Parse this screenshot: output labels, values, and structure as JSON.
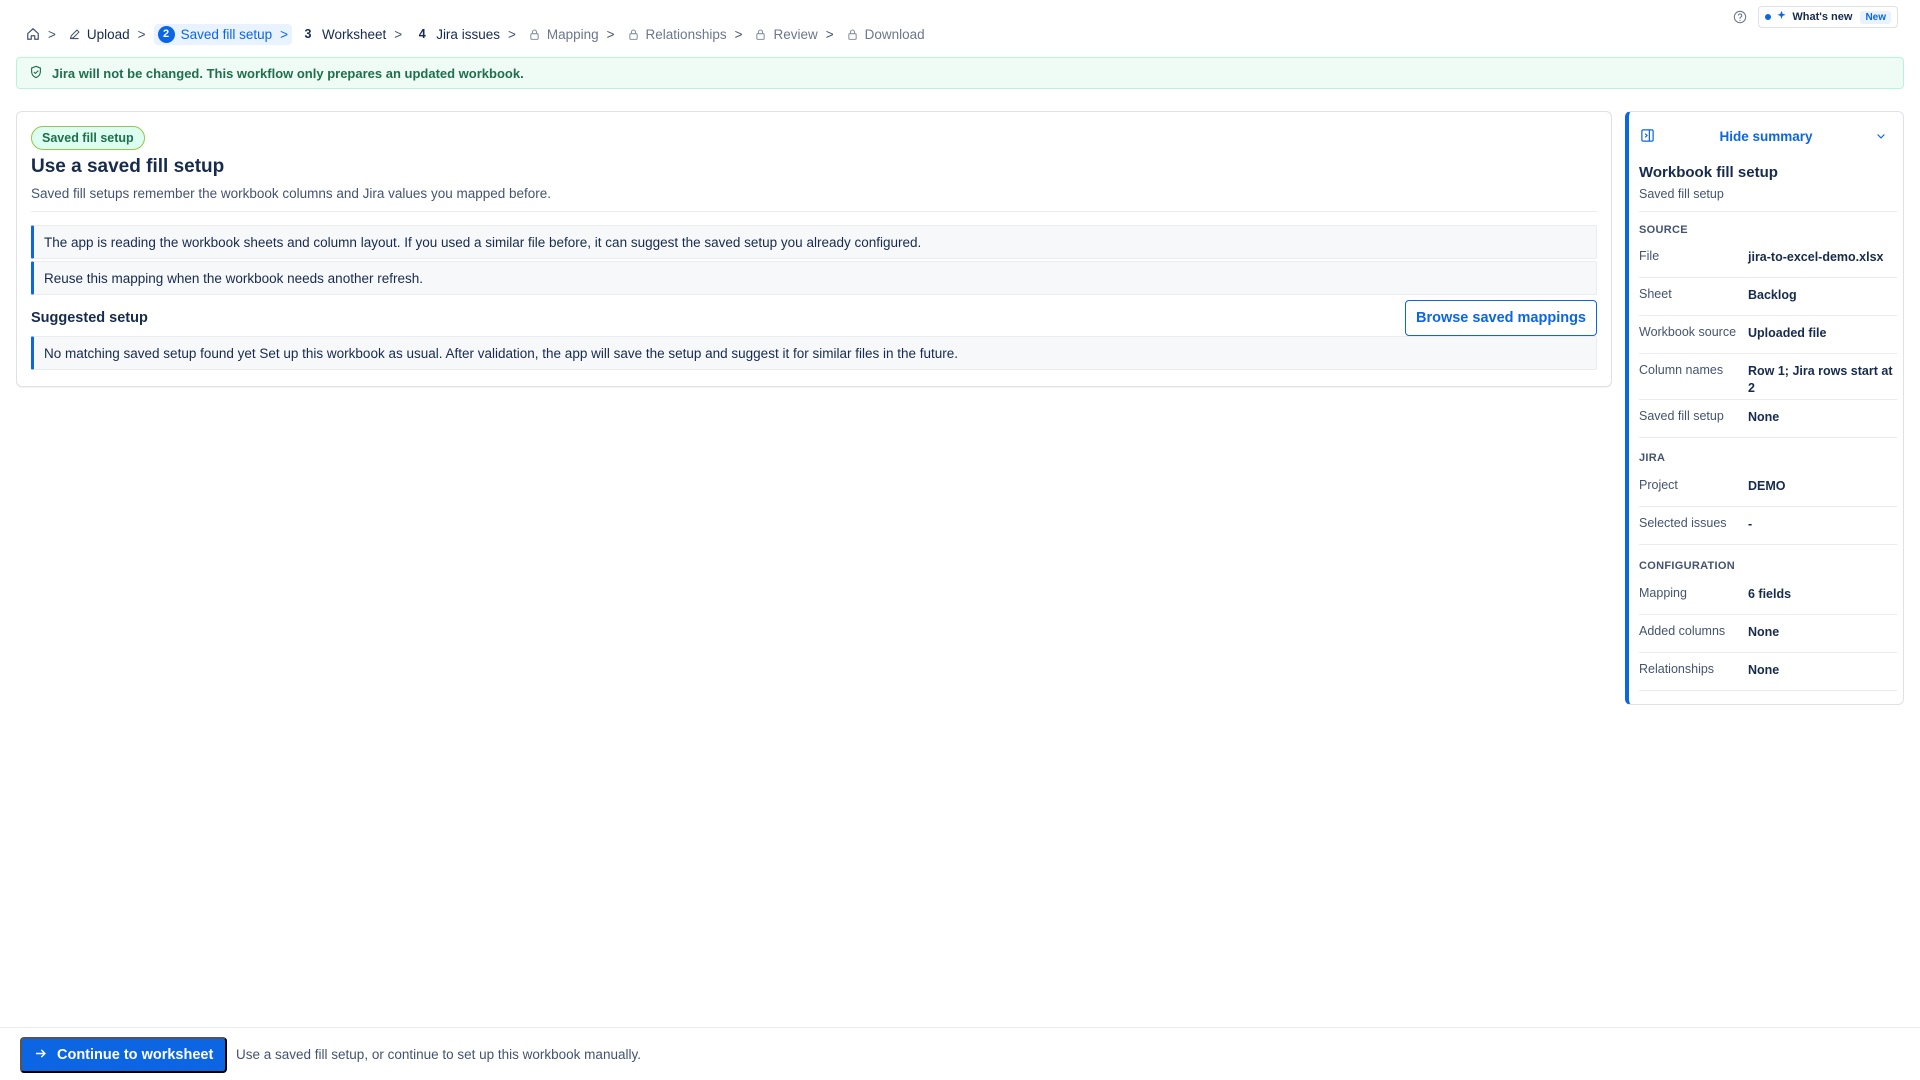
{
  "breadcrumb": {
    "separator": ">",
    "steps": [
      {
        "label": "Upload",
        "state": "done"
      },
      {
        "label": "Saved fill setup",
        "number": "2",
        "state": "active"
      },
      {
        "label": "Worksheet",
        "number": "3",
        "state": "open"
      },
      {
        "label": "Jira issues",
        "number": "4",
        "state": "open"
      },
      {
        "label": "Mapping",
        "state": "locked"
      },
      {
        "label": "Relationships",
        "state": "locked"
      },
      {
        "label": "Review",
        "state": "locked"
      },
      {
        "label": "Download",
        "state": "locked"
      }
    ]
  },
  "header": {
    "whats_new_label": "What's new",
    "whats_new_badge": "New"
  },
  "banner": {
    "text": "Jira will not be changed. This workflow only prepares an updated workbook."
  },
  "main": {
    "pill": "Saved fill setup",
    "title": "Use a saved fill setup",
    "description": "Saved fill setups remember the workbook columns and Jira values you mapped before.",
    "info_1": "The app is reading the workbook sheets and column layout. If you used a similar file before, it can suggest the saved setup you already configured.",
    "info_2": "Reuse this mapping when the workbook needs another refresh.",
    "suggested_heading": "Suggested setup",
    "browse_button": "Browse saved mappings",
    "no_match": "No matching saved setup found yet Set up this workbook as usual. After validation, the app will save the setup and suggest it for similar files in the future."
  },
  "summary": {
    "hide_label": "Hide summary",
    "title": "Workbook fill setup",
    "subtitle": "Saved fill setup",
    "source_heading": "SOURCE",
    "source": [
      {
        "k": "File",
        "v": "jira-to-excel-demo.xlsx"
      },
      {
        "k": "Sheet",
        "v": "Backlog"
      },
      {
        "k": "Workbook source",
        "v": "Uploaded file"
      },
      {
        "k": "Column names",
        "v": "Row 1; Jira rows start at 2"
      },
      {
        "k": "Saved fill setup",
        "v": "None"
      }
    ],
    "jira_heading": "JIRA",
    "jira": [
      {
        "k": "Project",
        "v": "DEMO"
      },
      {
        "k": "Selected issues",
        "v": "-"
      }
    ],
    "config_heading": "CONFIGURATION",
    "config": [
      {
        "k": "Mapping",
        "v": "6 fields"
      },
      {
        "k": "Added columns",
        "v": "None"
      },
      {
        "k": "Relationships",
        "v": "None"
      }
    ]
  },
  "footer": {
    "continue_button": "Continue to worksheet",
    "hint": "Use a saved fill setup, or continue to set up this workbook manually."
  },
  "colors": {
    "brand": "#0c66e4",
    "success_bg": "#effcf6",
    "success_text": "#216e4e"
  },
  "icons": [
    "home-icon",
    "pencil-icon",
    "lock-icon",
    "help-icon",
    "sparkle-icon",
    "shield-check-icon",
    "panel-icon",
    "chevron-down-icon",
    "arrow-right-icon"
  ]
}
